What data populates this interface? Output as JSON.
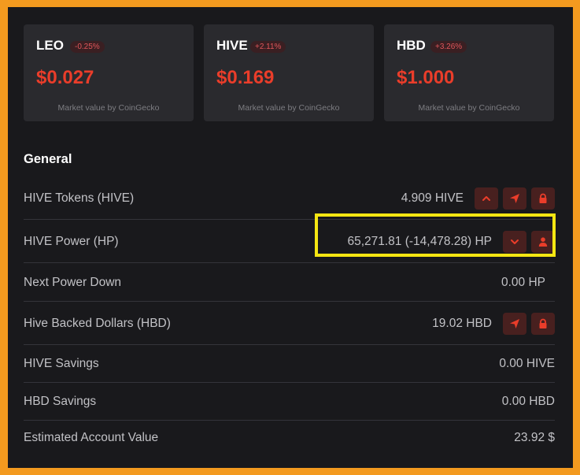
{
  "market_cards": [
    {
      "symbol": "LEO",
      "change": "-0.25%",
      "price": "$0.027",
      "source": "Market value by CoinGecko"
    },
    {
      "symbol": "HIVE",
      "change": "+2.11%",
      "price": "$0.169",
      "source": "Market value by CoinGecko"
    },
    {
      "symbol": "HBD",
      "change": "+3.26%",
      "price": "$1.000",
      "source": "Market value by CoinGecko"
    }
  ],
  "general": {
    "title": "General",
    "rows": [
      {
        "label": "HIVE Tokens (HIVE)",
        "value": "4.909 HIVE",
        "actions": [
          "chevron-up-icon",
          "send-icon",
          "lock-icon"
        ]
      },
      {
        "label": "HIVE Power (HP)",
        "value": "65,271.81 (-14,478.28) HP",
        "actions": [
          "chevron-down-icon",
          "user-icon"
        ]
      },
      {
        "label": "Next Power Down",
        "value": "0.00 HP",
        "actions": []
      },
      {
        "label": "Hive Backed Dollars (HBD)",
        "value": "19.02 HBD",
        "actions": [
          "send-icon",
          "lock-icon"
        ]
      },
      {
        "label": "HIVE Savings",
        "value": "0.00 HIVE",
        "actions": []
      },
      {
        "label": "HBD Savings",
        "value": "0.00 HBD",
        "actions": []
      },
      {
        "label": "Estimated Account Value",
        "value": "23.92 $",
        "actions": []
      }
    ]
  },
  "colors": {
    "accent": "#ea3d2a",
    "highlight_box": "#f5e612",
    "frame": "#f39a1f"
  }
}
